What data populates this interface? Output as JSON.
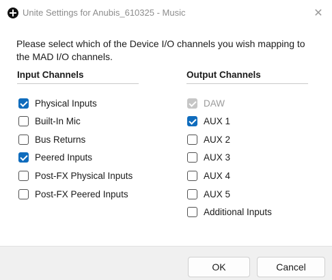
{
  "window": {
    "title": "Unite Settings for Anubis_610325 - Music",
    "close_glyph": "✕"
  },
  "intro_text": "Please select which of the Device I/O channels you wish mapping to the MAD I/O channels.",
  "input_channels": {
    "header": "Input Channels",
    "items": [
      {
        "label": "Physical Inputs",
        "checked": true,
        "disabled": false
      },
      {
        "label": "Built-In Mic",
        "checked": false,
        "disabled": false
      },
      {
        "label": "Bus Returns",
        "checked": false,
        "disabled": false
      },
      {
        "label": "Peered Inputs",
        "checked": true,
        "disabled": false
      },
      {
        "label": "Post-FX Physical Inputs",
        "checked": false,
        "disabled": false
      },
      {
        "label": "Post-FX Peered Inputs",
        "checked": false,
        "disabled": false
      }
    ]
  },
  "output_channels": {
    "header": "Output Channels",
    "items": [
      {
        "label": "DAW",
        "checked": true,
        "disabled": true
      },
      {
        "label": "AUX 1",
        "checked": true,
        "disabled": false
      },
      {
        "label": "AUX 2",
        "checked": false,
        "disabled": false
      },
      {
        "label": "AUX 3",
        "checked": false,
        "disabled": false
      },
      {
        "label": "AUX 4",
        "checked": false,
        "disabled": false
      },
      {
        "label": "AUX 5",
        "checked": false,
        "disabled": false
      },
      {
        "label": "Additional Inputs",
        "checked": false,
        "disabled": false
      }
    ]
  },
  "buttons": {
    "ok_label": "OK",
    "cancel_label": "Cancel"
  },
  "colors": {
    "accent": "#0f6cbd",
    "disabled_check": "#c6c6c6",
    "footer_bg": "#f0f0f0"
  }
}
